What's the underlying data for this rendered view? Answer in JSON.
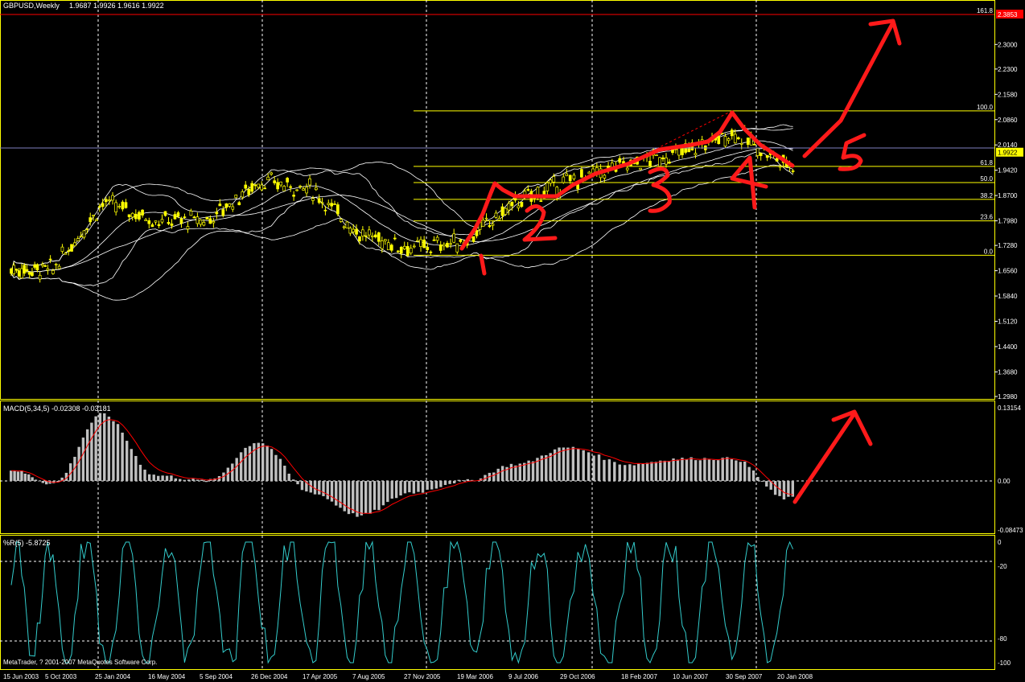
{
  "header": {
    "symbol": "GBPUSD,Weekly",
    "ohlc": "1.9687 1.9926 1.9616 1.9922"
  },
  "copyright": "MetaTrader, ? 2001-2007 MetaQuotes Software Corp.",
  "colors": {
    "background": "#000000",
    "grid": "#ffffff",
    "panel_border": "#ffff00",
    "candle": "#ffff00",
    "bands": "#ffffff",
    "fib_lines": "#ffff00",
    "macd_hist": "#c0c0c0",
    "macd_signal": "#ff0000",
    "wpr": "#33cccc",
    "annotation": "#ff0000",
    "price_line": "#8080c0"
  },
  "chart_data": [
    {
      "type": "candlestick",
      "panel": "main",
      "title": "GBPUSD,Weekly",
      "price_axis_labels": [
        "2.3000",
        "2.2300",
        "2.1580",
        "2.0860",
        "2.0140",
        "1.9420",
        "1.8700",
        "1.7980",
        "1.7280",
        "1.6560",
        "1.5840",
        "1.5120",
        "1.4400",
        "1.3680",
        "1.2980"
      ],
      "current_price_label": "1.9922",
      "top_marker_label": "2.3853",
      "time_axis_labels": [
        "15 Jun 2003",
        "5 Oct 2003",
        "25 Jan 2004",
        "16 May 2004",
        "5 Sep 2004",
        "26 Dec 2004",
        "17 Apr 2005",
        "7 Aug 2005",
        "27 Nov 2005",
        "19 Mar 2006",
        "9 Jul 2006",
        "29 Oct 2006",
        "18 Feb 2007",
        "10 Jun 2007",
        "30 Sep 2007",
        "20 Jan 2008"
      ],
      "ylim": [
        1.298,
        2.3853
      ],
      "price_path_keypoints": [
        {
          "date": "15 Jun 2003",
          "price": 1.66
        },
        {
          "date": "5 Oct 2003",
          "price": 1.66
        },
        {
          "date": "25 Jan 2004",
          "price": 1.85
        },
        {
          "date": "16 May 2004",
          "price": 1.8
        },
        {
          "date": "5 Sep 2004",
          "price": 1.8
        },
        {
          "date": "26 Dec 2004",
          "price": 1.91
        },
        {
          "date": "17 Apr 2005",
          "price": 1.89
        },
        {
          "date": "7 Aug 2005",
          "price": 1.76
        },
        {
          "date": "27 Nov 2005",
          "price": 1.72
        },
        {
          "date": "19 Mar 2006",
          "price": 1.74
        },
        {
          "date": "9 Jul 2006",
          "price": 1.85
        },
        {
          "date": "29 Oct 2006",
          "price": 1.91
        },
        {
          "date": "18 Feb 2007",
          "price": 1.96
        },
        {
          "date": "10 Jun 2007",
          "price": 1.99
        },
        {
          "date": "30 Sep 2007",
          "price": 2.05
        },
        {
          "date": "20 Jan 2008",
          "price": 1.96
        }
      ],
      "fibonacci_levels": [
        {
          "label": "161.8",
          "price": 2.3853
        },
        {
          "label": "100.0",
          "price": 2.111
        },
        {
          "label": "61.8",
          "price": 1.953
        },
        {
          "label": "50.0",
          "price": 1.907
        },
        {
          "label": "38.2",
          "price": 1.859
        },
        {
          "label": "23.6",
          "price": 1.798
        },
        {
          "label": "0.0",
          "price": 1.7
        }
      ],
      "annotations": [
        "1",
        "2",
        "3",
        "4",
        "5"
      ]
    },
    {
      "type": "bar",
      "panel": "macd",
      "title": "MACD(5,34,5) -0.02308 -0.03181",
      "axis_labels": [
        "0.13154",
        "0.00",
        "-0.08473"
      ],
      "ylim": [
        -0.08473,
        0.13154
      ],
      "histogram_keypoints": [
        {
          "date": "15 Jun 2003",
          "value": 0.02
        },
        {
          "date": "5 Oct 2003",
          "value": -0.005
        },
        {
          "date": "25 Jan 2004",
          "value": 0.12
        },
        {
          "date": "16 May 2004",
          "value": 0.01
        },
        {
          "date": "5 Sep 2004",
          "value": 0.0
        },
        {
          "date": "26 Dec 2004",
          "value": 0.07
        },
        {
          "date": "17 Apr 2005",
          "value": -0.02
        },
        {
          "date": "7 Aug 2005",
          "value": -0.06
        },
        {
          "date": "27 Nov 2005",
          "value": -0.02
        },
        {
          "date": "19 Mar 2006",
          "value": 0.0
        },
        {
          "date": "9 Jul 2006",
          "value": 0.03
        },
        {
          "date": "29 Oct 2006",
          "value": 0.06
        },
        {
          "date": "18 Feb 2007",
          "value": 0.03
        },
        {
          "date": "10 Jun 2007",
          "value": 0.04
        },
        {
          "date": "30 Sep 2007",
          "value": 0.04
        },
        {
          "date": "20 Jan 2008",
          "value": -0.03
        }
      ]
    },
    {
      "type": "line",
      "panel": "wpr",
      "title": "%R(5) -5.8725",
      "axis_labels": [
        "0",
        "-20",
        "-80",
        "-100"
      ],
      "ylim": [
        -100,
        0
      ],
      "levels": [
        -20,
        -80
      ]
    }
  ]
}
